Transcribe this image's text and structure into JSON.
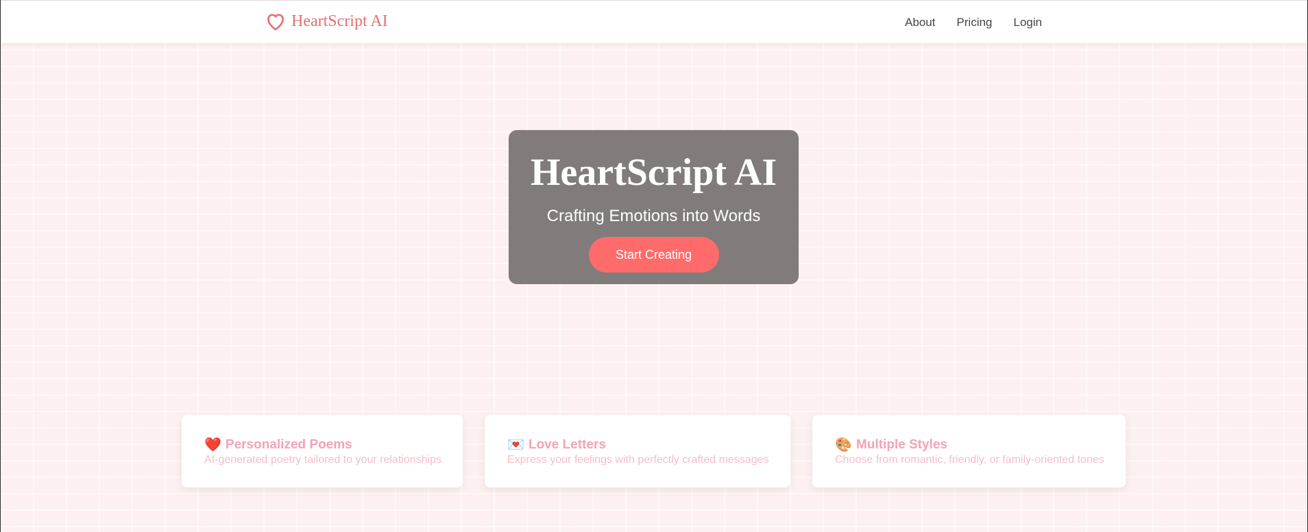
{
  "brand": {
    "name": "HeartScript AI",
    "icon": "heart-outline-icon",
    "color": "#e86f6f"
  },
  "nav": {
    "links": [
      {
        "label": "About"
      },
      {
        "label": "Pricing"
      },
      {
        "label": "Login"
      }
    ]
  },
  "hero": {
    "title": "HeartScript AI",
    "subtitle": "Crafting Emotions into Words",
    "cta_label": "Start Creating",
    "cta_color": "#ff6b6b"
  },
  "features": [
    {
      "icon": "❤️",
      "icon_name": "red-heart-icon",
      "title": "Personalized Poems",
      "description": "AI-generated poetry tailored to your relationships"
    },
    {
      "icon": "💌",
      "icon_name": "love-letter-icon",
      "title": "Love Letters",
      "description": "Express your feelings with perfectly crafted messages"
    },
    {
      "icon": "🎨",
      "icon_name": "palette-icon",
      "title": "Multiple Styles",
      "description": "Choose from romantic, friendly, or family-oriented tones"
    }
  ]
}
